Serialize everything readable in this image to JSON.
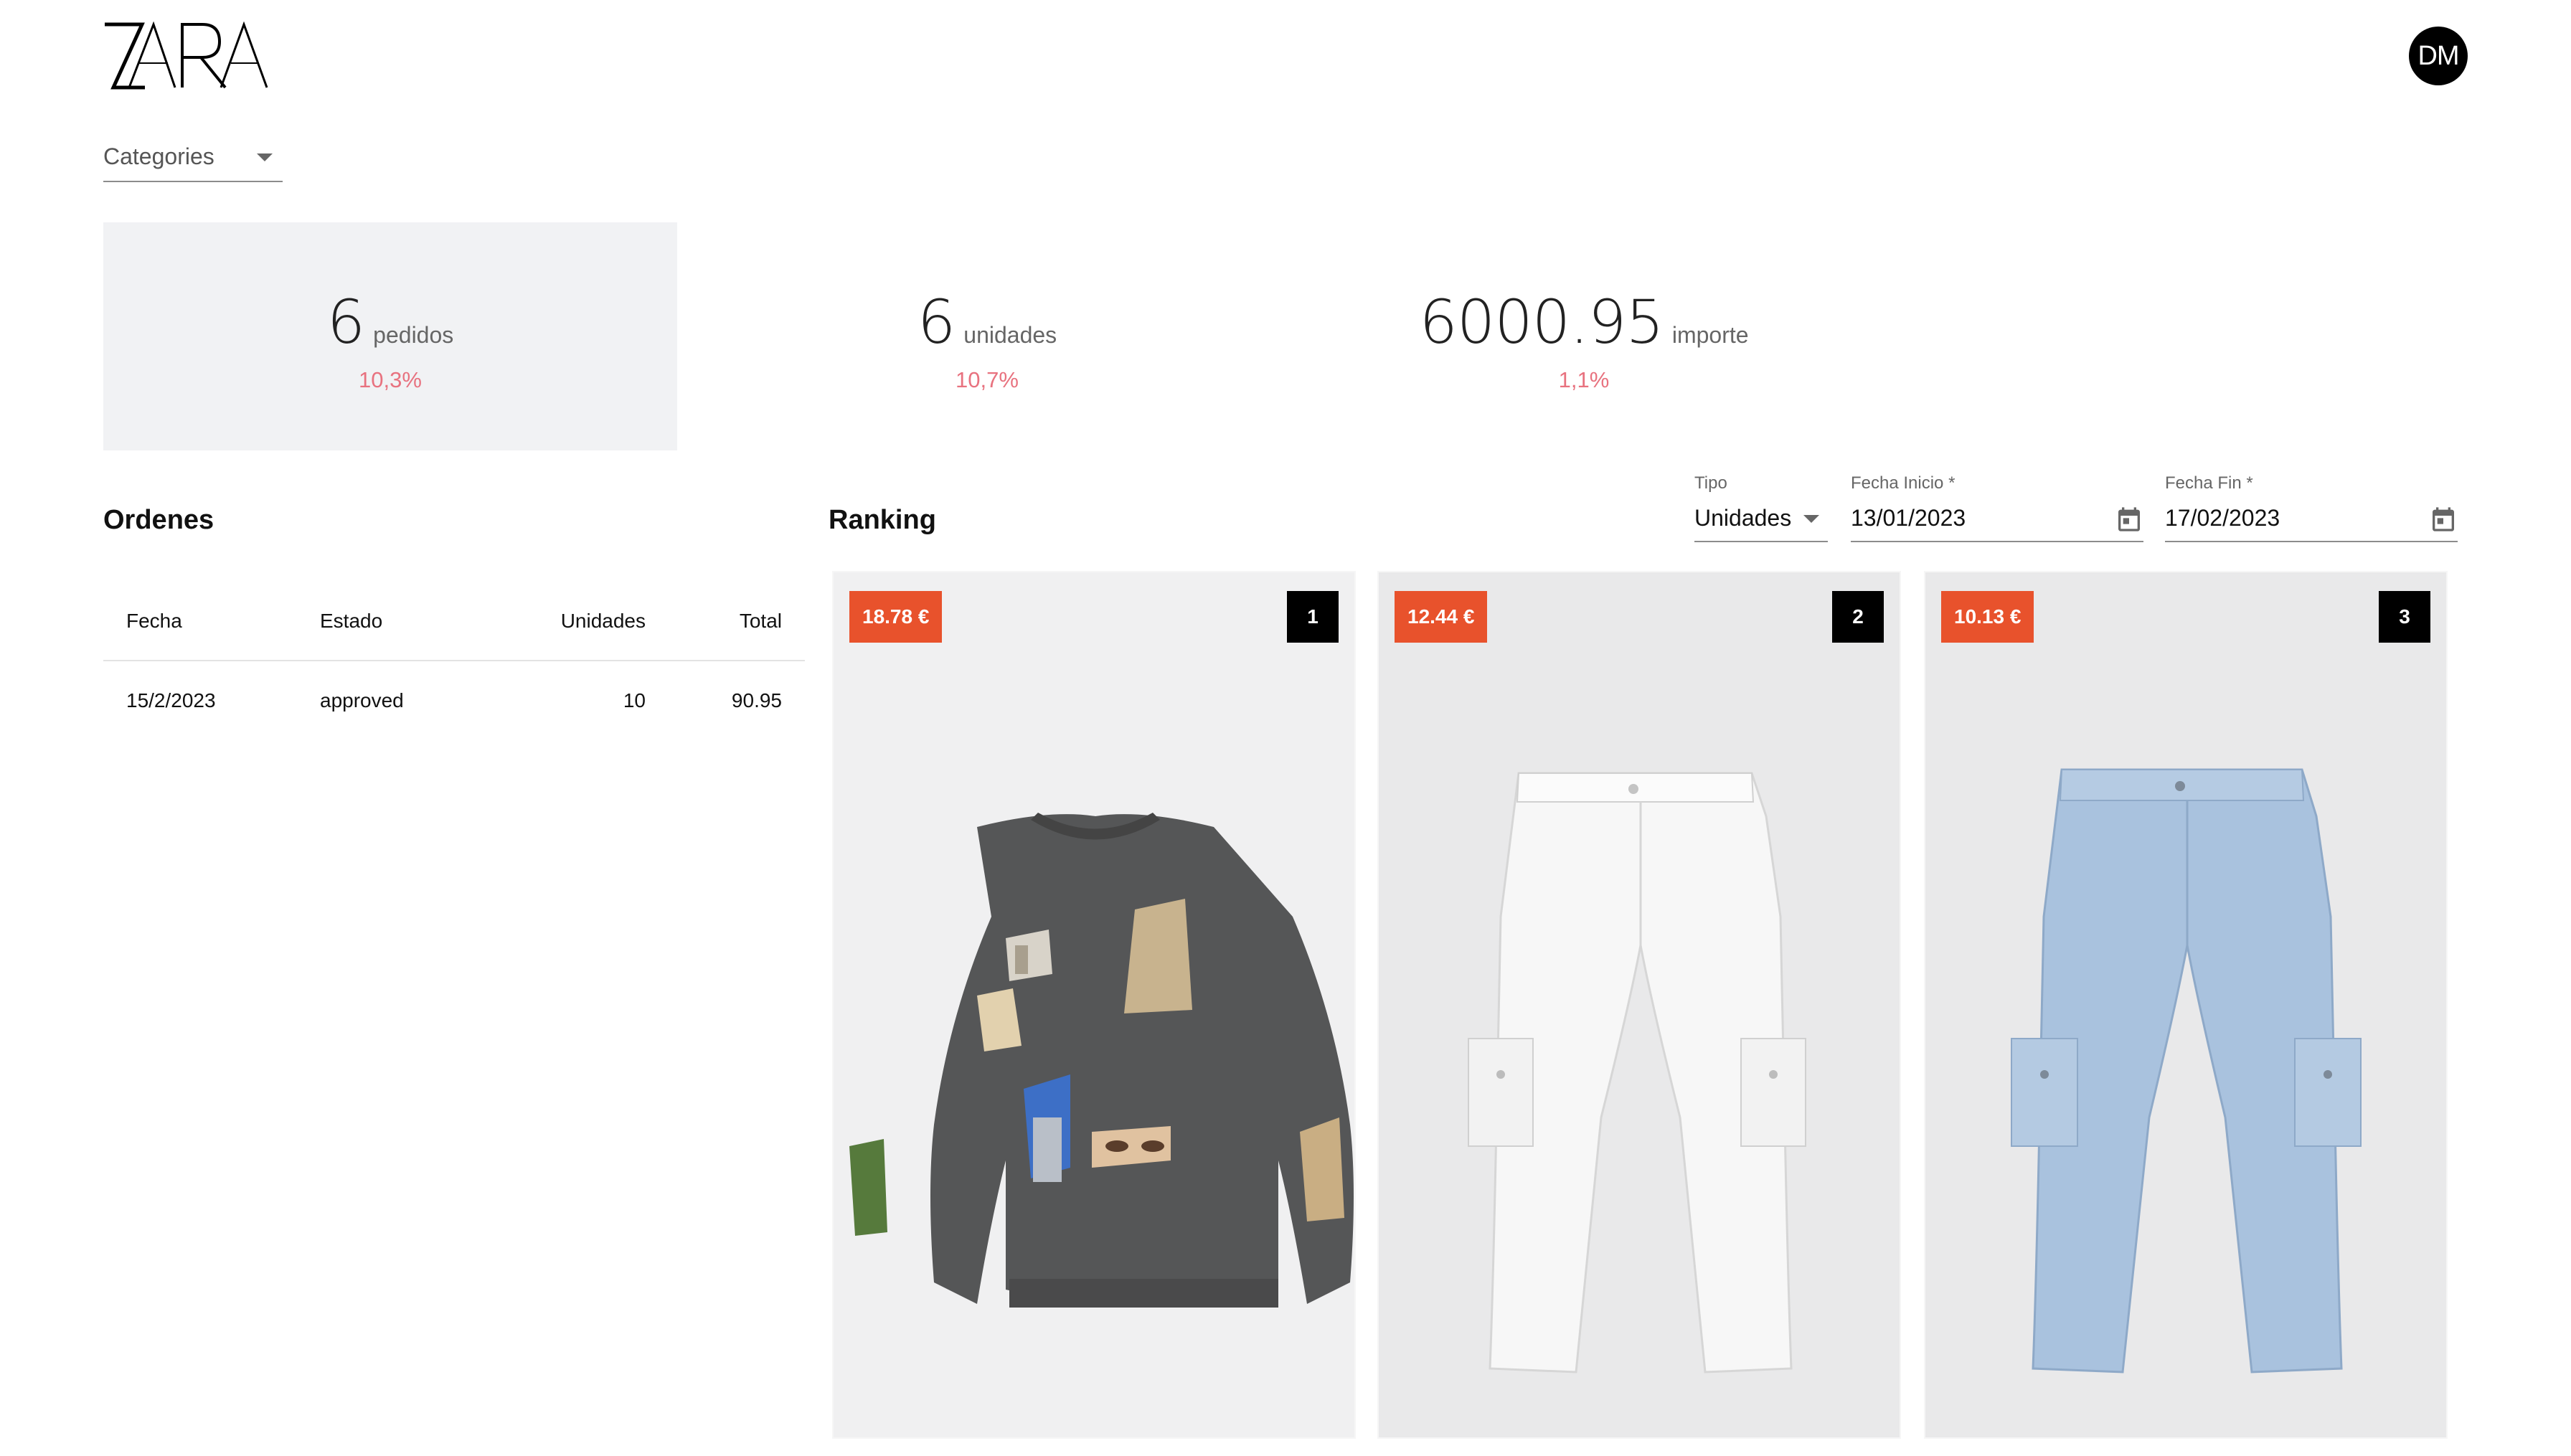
{
  "header": {
    "logo": "ZARA",
    "avatar_initials": "DM"
  },
  "filters": {
    "categories_label": "Categories"
  },
  "kpis": [
    {
      "value": "6",
      "unit": "pedidos",
      "change": "10,3%"
    },
    {
      "value": "6",
      "unit": "unidades",
      "change": "10,7%"
    },
    {
      "value": "6000.95",
      "unit": "importe",
      "change": "1,1%"
    }
  ],
  "orders": {
    "title": "Ordenes",
    "columns": [
      "Fecha",
      "Estado",
      "Unidades",
      "Total"
    ],
    "rows": [
      {
        "fecha": "15/2/2023",
        "estado": "approved",
        "unidades": "10",
        "total": "90.95"
      }
    ]
  },
  "ranking": {
    "title": "Ranking",
    "tipo_label": "Tipo",
    "tipo_value": "Unidades",
    "fecha_inicio_label": "Fecha Inicio *",
    "fecha_inicio_value": "13/01/2023",
    "fecha_fin_label": "Fecha Fin *",
    "fecha_fin_value": "17/02/2023",
    "products": [
      {
        "price": "18.78 €",
        "rank": "1",
        "item": "sweatshirt"
      },
      {
        "price": "12.44 €",
        "rank": "2",
        "item": "white-cargo-jeans"
      },
      {
        "price": "10.13 €",
        "rank": "3",
        "item": "light-blue-cargo-jeans"
      }
    ]
  },
  "colors": {
    "accent_orange": "#e8522c",
    "change_red": "#e8727f",
    "card_selected_bg": "#f1f2f4"
  }
}
